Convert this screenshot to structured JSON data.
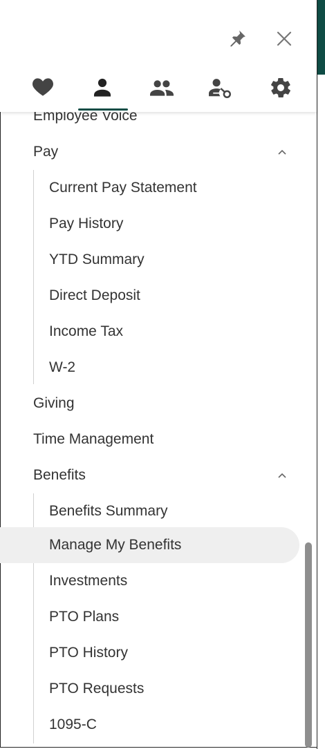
{
  "header": {
    "icons": {
      "pin": "pin-icon",
      "close": "close-icon",
      "tabs": [
        "heart-icon",
        "person-icon",
        "people-icon",
        "person-key-icon",
        "gear-icon"
      ]
    },
    "active_tab": "person-icon"
  },
  "colors": {
    "accent": "#0f4c45",
    "text": "#333333",
    "icon": "#444444",
    "highlight": "#efefef"
  },
  "nav": {
    "employee_voice": "Employee Voice",
    "pay": {
      "label": "Pay",
      "items": [
        "Current Pay Statement",
        "Pay History",
        "YTD Summary",
        "Direct Deposit",
        "Income Tax",
        "W-2"
      ]
    },
    "giving": "Giving",
    "time_management": "Time Management",
    "benefits": {
      "label": "Benefits",
      "items": [
        "Benefits Summary",
        "Manage My Benefits",
        "Investments",
        "PTO Plans",
        "PTO History",
        "PTO Requests",
        "1095-C"
      ]
    },
    "selected": "Manage My Benefits"
  }
}
